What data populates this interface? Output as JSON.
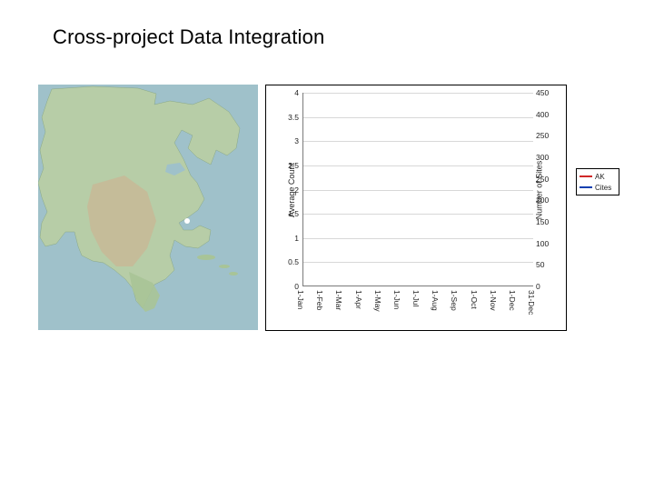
{
  "title": "Cross-project Data Integration",
  "legend": {
    "items": [
      {
        "label": "AK",
        "color": "#d02828"
      },
      {
        "label": "Cites",
        "color": "#1040b0"
      }
    ]
  },
  "chart_data": {
    "type": "line",
    "categories": [
      "1-Jan",
      "1-Feb",
      "1-Mar",
      "1-Apr",
      "1-May",
      "1-Jun",
      "1-Jul",
      "1-Aug",
      "1-Sep",
      "1-Oct",
      "1-Nov",
      "1-Dec",
      "31-Dec"
    ],
    "series": [
      {
        "name": "AK",
        "axis": "left",
        "values": [
          null,
          null,
          null,
          null,
          null,
          null,
          null,
          null,
          null,
          null,
          null,
          null,
          null
        ]
      },
      {
        "name": "Cites",
        "axis": "right",
        "values": [
          null,
          null,
          null,
          null,
          null,
          null,
          null,
          null,
          null,
          null,
          null,
          null,
          null
        ]
      }
    ],
    "title": "",
    "xlabel": "",
    "ylabel_left": "Average Count",
    "ylabel_right": "Number of Sites",
    "ylim_left": [
      0,
      4
    ],
    "yticks_left": [
      0,
      0.5,
      1,
      1.5,
      2,
      2.5,
      3,
      3.5,
      4
    ],
    "ylim_right": [
      0,
      450
    ],
    "yticks_right": [
      0,
      50,
      100,
      150,
      200,
      250,
      300,
      250,
      400,
      450
    ],
    "grid_y": true
  }
}
